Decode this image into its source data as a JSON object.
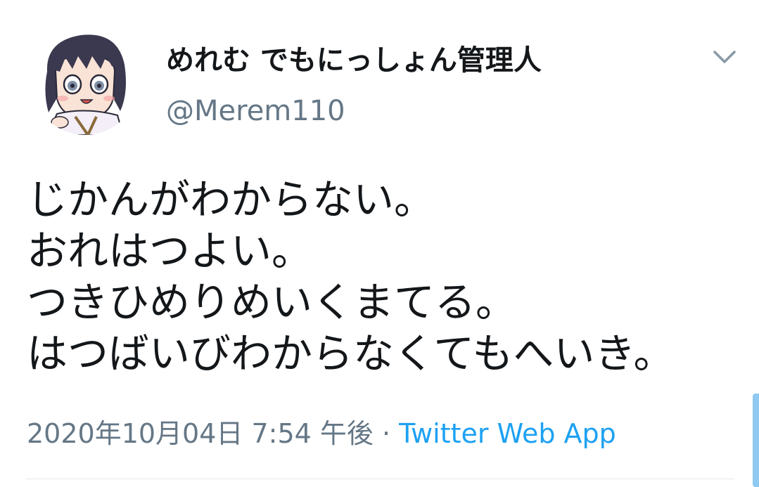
{
  "tweet": {
    "author": {
      "display_name": "めれむ でもにっしょん管理人",
      "handle": "@Merem110",
      "avatar_icon": "anime-character-avatar"
    },
    "text_lines": [
      "じかんがわからない。",
      "おれはつよい。",
      "つきひめりめいくまてる。",
      "はつばいびわからなくてもへいき。"
    ],
    "timestamp": "2020年10月04日 7:54 午後",
    "separator": " · ",
    "source": "Twitter Web App"
  },
  "icons": {
    "menu": "chevron-down-icon"
  },
  "colors": {
    "text": "#14171a",
    "secondary": "#657786",
    "link": "#1da1f2",
    "divider": "#e1e8ed"
  }
}
